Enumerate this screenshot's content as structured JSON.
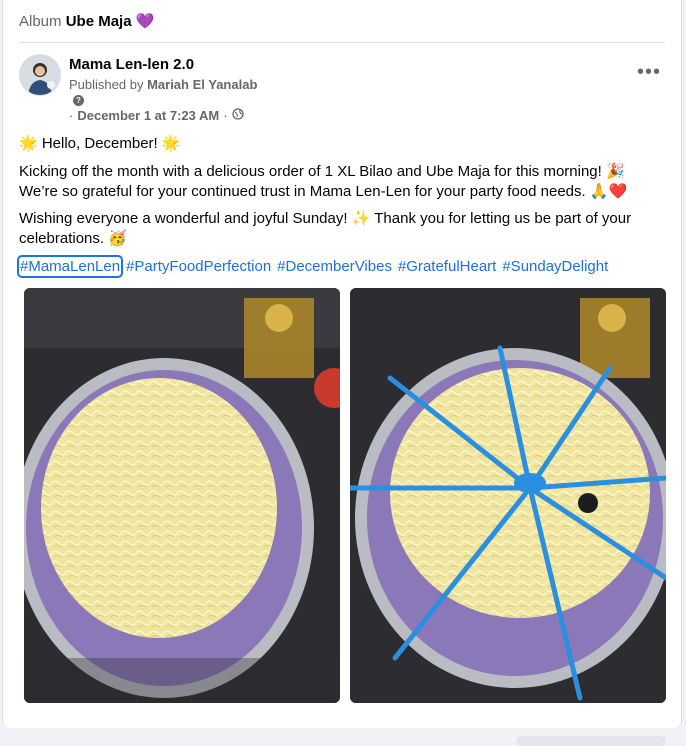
{
  "album": {
    "prefix": "Album",
    "name": "Ube Maja 💜"
  },
  "post": {
    "page_name": "Mama Len-len 2.0",
    "published_prefix": "Published by",
    "published_by": "Mariah El Yanalab",
    "date": "December 1 at 7:23 AM",
    "date_prefix": "·",
    "audience_icon": "globe-icon",
    "more_label": "•••",
    "line1": "🌟 Hello, December! 🌟",
    "line2a": "Kicking off the month with a delicious order of 1 XL Bilao and Ube Maja for this morning! 🎉",
    "line2b": "We’re so grateful for your continued trust in Mama Len-Len for your party food needs. 🙏❤️",
    "line3a": "Wishing everyone a wonderful and joyful Sunday! ✨ Thank you for letting us be part of your",
    "line3b": "celebrations. 🥳",
    "hashtags": [
      "#MamaLenLen",
      "#PartyFoodPerfection",
      "#DecemberVibes",
      "#GratefulHeart",
      "#SundayDelight"
    ]
  },
  "colors": {
    "link": "#216fdb",
    "ube": "#8b78b8",
    "cheese": "#f3eaa6",
    "ribbon": "#2b8fe0",
    "foil": "#b9bcc2"
  }
}
